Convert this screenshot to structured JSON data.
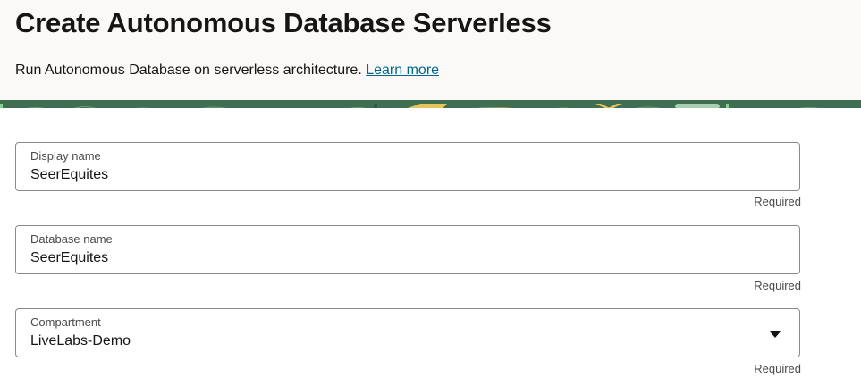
{
  "header": {
    "title": "Create Autonomous Database Serverless",
    "subtitle": "Run Autonomous Database on serverless architecture.",
    "learn_more": "Learn more"
  },
  "form": {
    "display_name": {
      "label": "Display name",
      "value": "SeerEquites",
      "helper": "Required"
    },
    "database_name": {
      "label": "Database name",
      "value": "SeerEquites",
      "helper": "Required"
    },
    "compartment": {
      "label": "Compartment",
      "value": "LiveLabs-Demo",
      "helper": "Required",
      "icon": "chevron-down-icon"
    }
  },
  "colors": {
    "header_bg": "#fbf9f8",
    "link": "#00688c",
    "banner_green": "#3f6f52",
    "banner_accent": "#e8c25c"
  }
}
